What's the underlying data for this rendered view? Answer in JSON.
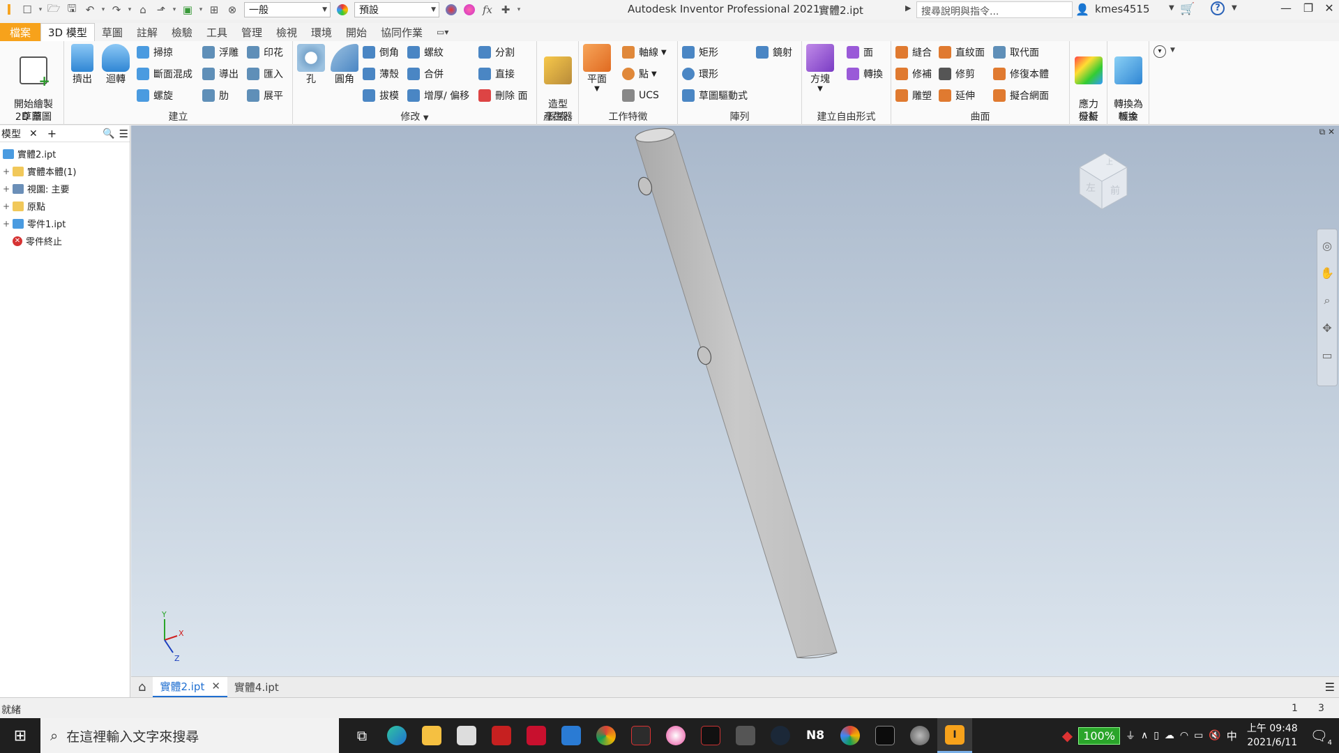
{
  "titlebar": {
    "appearance_combo": "一般",
    "material_combo": "預設",
    "app_title": "Autodesk Inventor Professional 2021",
    "document_title": "實體2.ipt",
    "help_search_placeholder": "搜尋說明與指令...",
    "user_name": "kmes4515"
  },
  "ribbon_tabs": [
    "檔案",
    "3D 模型",
    "草圖",
    "註解",
    "檢驗",
    "工具",
    "管理",
    "檢視",
    "環境",
    "開始",
    "協同作業"
  ],
  "ribbon": {
    "sketch_panel": {
      "label": "草圖",
      "start_sketch": "開始繪製\n2D 草圖"
    },
    "create_panel": {
      "label": "建立",
      "extrude": "擠出",
      "revolve": "迴轉",
      "sweep": "掃掠",
      "loft": "斷面混成",
      "coil": "螺旋",
      "emboss": "浮雕",
      "derive": "導出",
      "rib": "肋",
      "decal": "印花",
      "import": "匯入",
      "unfold": "展平"
    },
    "modify_panel": {
      "label": "修改",
      "hole": "孔",
      "fillet": "圓角",
      "chamfer": "倒角",
      "shell": "薄殼",
      "draft": "拔模",
      "thread": "螺紋",
      "combine": "合併",
      "thicken": "增厚/ 偏移",
      "split": "分割",
      "direct": "直接",
      "delete_face": "刪除 面"
    },
    "explore_panel": {
      "label": "探索",
      "shape_generator": "造型\n產生器"
    },
    "workfeatures_panel": {
      "label": "工作特徵",
      "plane": "平面",
      "axis": "軸線",
      "point": "點",
      "ucs": "UCS"
    },
    "pattern_panel": {
      "label": "陣列",
      "rectangular": "矩形",
      "circular": "環形",
      "sketch_driven": "草圖驅動式",
      "mirror": "鏡射"
    },
    "freeform_panel": {
      "label": "建立自由形式",
      "box": "方塊",
      "face": "面",
      "convert": "轉換"
    },
    "surface_panel": {
      "label": "曲面",
      "stitch": "縫合",
      "patch": "修補",
      "sculpt": "雕塑",
      "ruled": "直紋面",
      "trim": "修剪",
      "extend": "延伸",
      "replace_face": "取代面",
      "repair": "修復本體",
      "fit_mesh": "擬合網面"
    },
    "simulation_panel": {
      "label": "模擬",
      "stress": "應力\n分析"
    },
    "convert_panel": {
      "label": "轉換",
      "to_sheet_metal": "轉換為\n板金"
    }
  },
  "browser": {
    "tab_label": "模型",
    "items": [
      {
        "label": "實體2.ipt",
        "icon": "part-icon",
        "expander": ""
      },
      {
        "label": "實體本體(1)",
        "icon": "folder-icon",
        "expander": "+"
      },
      {
        "label": "視圖: 主要",
        "icon": "view-icon",
        "expander": "+"
      },
      {
        "label": "原點",
        "icon": "folder-icon",
        "expander": "+"
      },
      {
        "label": "零件1.ipt",
        "icon": "part-icon",
        "expander": "+"
      },
      {
        "label": "零件終止",
        "icon": "end-of-part-icon",
        "expander": ""
      }
    ]
  },
  "viewcube": {
    "face_left": "左",
    "face_front": "前",
    "face_top": "上"
  },
  "axis_labels": {
    "x": "X",
    "y": "Y",
    "z": "Z"
  },
  "doc_tabs": [
    {
      "label": "實體2.ipt",
      "active": true
    },
    {
      "label": "實體4.ipt",
      "active": false
    }
  ],
  "status": {
    "text": "就緒",
    "count_a": "1",
    "count_b": "3"
  },
  "taskbar": {
    "search_placeholder": "在這裡輸入文字來搜尋",
    "battery": "100%",
    "ime": "中",
    "time": "上午 09:48",
    "date": "2021/6/11",
    "notifications": "4"
  },
  "colors": {
    "file_tab": "#f7a21b",
    "accent_blue": "#1f6fd1",
    "viewport_top": "#a9b8cb",
    "viewport_bottom": "#dce5ee"
  }
}
